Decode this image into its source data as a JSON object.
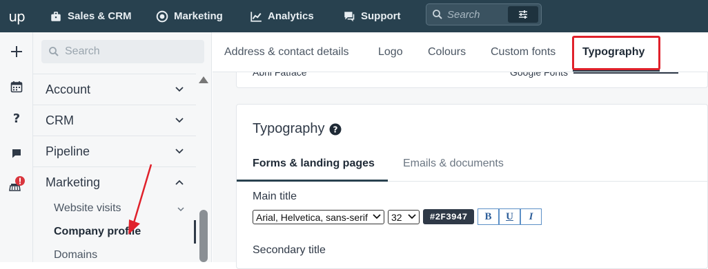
{
  "topbar": {
    "logo": "up",
    "nav": [
      {
        "label": "Sales & CRM",
        "icon": "briefcase-icon"
      },
      {
        "label": "Marketing",
        "icon": "target-icon"
      },
      {
        "label": "Analytics",
        "icon": "chart-line-icon"
      },
      {
        "label": "Support",
        "icon": "chat-icon"
      }
    ],
    "search": {
      "placeholder": "Search"
    }
  },
  "rail": [
    {
      "icon": "plus-icon"
    },
    {
      "icon": "calendar-icon"
    },
    {
      "icon": "question-icon"
    },
    {
      "icon": "comment-icon"
    },
    {
      "icon": "broom-alert-icon"
    }
  ],
  "sidebar": {
    "search_placeholder": "Search",
    "items": [
      {
        "label": "Account"
      },
      {
        "label": "CRM"
      },
      {
        "label": "Pipeline"
      },
      {
        "label": "Marketing"
      }
    ],
    "sub_items": [
      {
        "label": "Website visits"
      },
      {
        "label": "Company profile"
      },
      {
        "label": "Domains"
      }
    ]
  },
  "tabs": [
    {
      "label": "Address & contact details"
    },
    {
      "label": "Logo"
    },
    {
      "label": "Colours"
    },
    {
      "label": "Custom fonts"
    },
    {
      "label": "Typography"
    }
  ],
  "custom_fonts_row": {
    "font_name": "Abril Fatface",
    "source": "Google Fonts"
  },
  "typography": {
    "title": "Typography",
    "subtabs": [
      {
        "label": "Forms & landing pages"
      },
      {
        "label": "Emails & documents"
      }
    ],
    "main_title": {
      "label": "Main title",
      "font": "Arial, Helvetica, sans-serif",
      "size": "32",
      "color": "#2F3947",
      "bold": "B",
      "underline": "U",
      "italic": "I"
    },
    "secondary_title": {
      "label": "Secondary title"
    }
  },
  "colors": {
    "topbar": "#28414f",
    "accent": "#e0212b",
    "chip": "#2f3947"
  }
}
